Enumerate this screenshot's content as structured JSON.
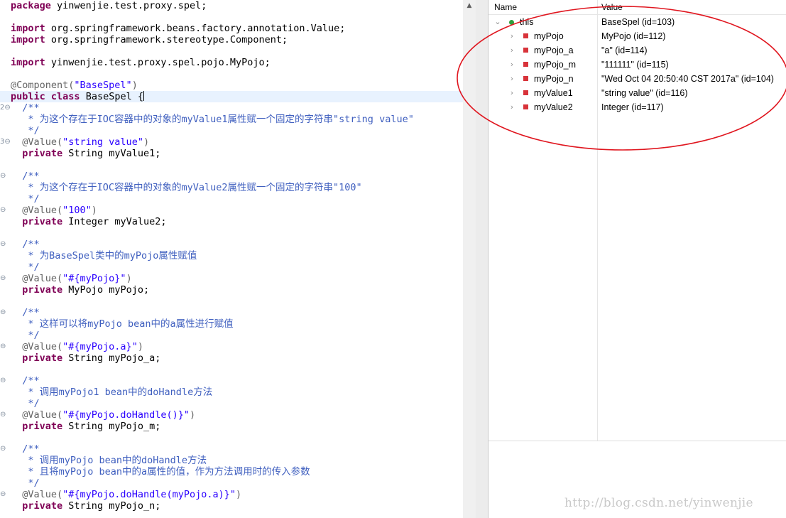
{
  "editor": {
    "lines": [
      {
        "gutter": "",
        "segments": [
          {
            "t": "package",
            "c": "kw"
          },
          {
            "t": " yinwenjie.test.proxy.spel;",
            "c": ""
          }
        ]
      },
      {
        "gutter": "",
        "segments": []
      },
      {
        "gutter": "",
        "segments": [
          {
            "t": "import",
            "c": "kw"
          },
          {
            "t": " org.springframework.beans.factory.annotation.Value;",
            "c": ""
          }
        ]
      },
      {
        "gutter": "",
        "segments": [
          {
            "t": "import",
            "c": "kw"
          },
          {
            "t": " org.springframework.stereotype.Component;",
            "c": ""
          }
        ]
      },
      {
        "gutter": "",
        "segments": []
      },
      {
        "gutter": "",
        "segments": [
          {
            "t": "import",
            "c": "kw"
          },
          {
            "t": " yinwenjie.test.proxy.spel.pojo.MyPojo;",
            "c": ""
          }
        ]
      },
      {
        "gutter": "",
        "segments": []
      },
      {
        "gutter": "",
        "segments": [
          {
            "t": "@Component(",
            "c": "ann"
          },
          {
            "t": "\"BaseSpel\"",
            "c": "str"
          },
          {
            "t": ")",
            "c": "ann"
          }
        ]
      },
      {
        "gutter": "",
        "current": true,
        "segments": [
          {
            "t": "public",
            "c": "kw"
          },
          {
            "t": " ",
            "c": ""
          },
          {
            "t": "class",
            "c": "kw"
          },
          {
            "t": " BaseSpel {",
            "c": ""
          }
        ]
      },
      {
        "gutter": "2⊖",
        "segments": [
          {
            "t": "  /**",
            "c": "doc"
          }
        ]
      },
      {
        "gutter": "",
        "segments": [
          {
            "t": "   * 为这个存在于IOC容器中的对象的myValue1属性赋一个固定的字符串\"string value\"",
            "c": "doc"
          }
        ]
      },
      {
        "gutter": "",
        "segments": [
          {
            "t": "   */",
            "c": "doc"
          }
        ]
      },
      {
        "gutter": "3⊖",
        "segments": [
          {
            "t": "  @Value(",
            "c": "ann"
          },
          {
            "t": "\"string value\"",
            "c": "str"
          },
          {
            "t": ")",
            "c": "ann"
          }
        ]
      },
      {
        "gutter": "",
        "segments": [
          {
            "t": "  ",
            "c": ""
          },
          {
            "t": "private",
            "c": "kw"
          },
          {
            "t": " String myValue1;",
            "c": ""
          }
        ]
      },
      {
        "gutter": "",
        "segments": []
      },
      {
        "gutter": "⊖",
        "segments": [
          {
            "t": "  /**",
            "c": "doc"
          }
        ]
      },
      {
        "gutter": "",
        "segments": [
          {
            "t": "   * 为这个存在于IOC容器中的对象的myValue2属性赋一个固定的字符串\"100\"",
            "c": "doc"
          }
        ]
      },
      {
        "gutter": "",
        "segments": [
          {
            "t": "   */",
            "c": "doc"
          }
        ]
      },
      {
        "gutter": "⊖",
        "segments": [
          {
            "t": "  @Value(",
            "c": "ann"
          },
          {
            "t": "\"100\"",
            "c": "str"
          },
          {
            "t": ")",
            "c": "ann"
          }
        ]
      },
      {
        "gutter": "",
        "segments": [
          {
            "t": "  ",
            "c": ""
          },
          {
            "t": "private",
            "c": "kw"
          },
          {
            "t": " Integer myValue2;",
            "c": ""
          }
        ]
      },
      {
        "gutter": "",
        "segments": []
      },
      {
        "gutter": "⊖",
        "segments": [
          {
            "t": "  /**",
            "c": "doc"
          }
        ]
      },
      {
        "gutter": "",
        "segments": [
          {
            "t": "   * 为BaseSpel类中的myPojo属性赋值",
            "c": "doc"
          }
        ]
      },
      {
        "gutter": "",
        "segments": [
          {
            "t": "   */",
            "c": "doc"
          }
        ]
      },
      {
        "gutter": "⊖",
        "segments": [
          {
            "t": "  @Value(",
            "c": "ann"
          },
          {
            "t": "\"#{myPojo}\"",
            "c": "str"
          },
          {
            "t": ")",
            "c": "ann"
          }
        ]
      },
      {
        "gutter": "",
        "segments": [
          {
            "t": "  ",
            "c": ""
          },
          {
            "t": "private",
            "c": "kw"
          },
          {
            "t": " MyPojo myPojo;",
            "c": ""
          }
        ]
      },
      {
        "gutter": "",
        "segments": []
      },
      {
        "gutter": "⊖",
        "segments": [
          {
            "t": "  /**",
            "c": "doc"
          }
        ]
      },
      {
        "gutter": "",
        "segments": [
          {
            "t": "   * 这样可以将myPojo bean中的a属性进行赋值",
            "c": "doc"
          }
        ]
      },
      {
        "gutter": "",
        "segments": [
          {
            "t": "   */",
            "c": "doc"
          }
        ]
      },
      {
        "gutter": "⊖",
        "segments": [
          {
            "t": "  @Value(",
            "c": "ann"
          },
          {
            "t": "\"#{myPojo.a}\"",
            "c": "str"
          },
          {
            "t": ")",
            "c": "ann"
          }
        ]
      },
      {
        "gutter": "",
        "segments": [
          {
            "t": "  ",
            "c": ""
          },
          {
            "t": "private",
            "c": "kw"
          },
          {
            "t": " String myPojo_a;",
            "c": ""
          }
        ]
      },
      {
        "gutter": "",
        "segments": []
      },
      {
        "gutter": "⊖",
        "segments": [
          {
            "t": "  /**",
            "c": "doc"
          }
        ]
      },
      {
        "gutter": "",
        "segments": [
          {
            "t": "   * 调用myPojo1 bean中的doHandle方法",
            "c": "doc"
          }
        ]
      },
      {
        "gutter": "",
        "segments": [
          {
            "t": "   */",
            "c": "doc"
          }
        ]
      },
      {
        "gutter": "⊖",
        "segments": [
          {
            "t": "  @Value(",
            "c": "ann"
          },
          {
            "t": "\"#{myPojo.doHandle()}\"",
            "c": "str"
          },
          {
            "t": ")",
            "c": "ann"
          }
        ]
      },
      {
        "gutter": "",
        "segments": [
          {
            "t": "  ",
            "c": ""
          },
          {
            "t": "private",
            "c": "kw"
          },
          {
            "t": " String myPojo_m;",
            "c": ""
          }
        ]
      },
      {
        "gutter": "",
        "segments": []
      },
      {
        "gutter": "⊖",
        "segments": [
          {
            "t": "  /**",
            "c": "doc"
          }
        ]
      },
      {
        "gutter": "",
        "segments": [
          {
            "t": "   * 调用myPojo bean中的doHandle方法",
            "c": "doc"
          }
        ]
      },
      {
        "gutter": "",
        "segments": [
          {
            "t": "   * 且将myPojo bean中的a属性的值，作为方法调用时的传入参数",
            "c": "doc"
          }
        ]
      },
      {
        "gutter": "",
        "segments": [
          {
            "t": "   */",
            "c": "doc"
          }
        ]
      },
      {
        "gutter": "⊖",
        "segments": [
          {
            "t": "  @Value(",
            "c": "ann"
          },
          {
            "t": "\"#{myPojo.doHandle(myPojo.a)}\"",
            "c": "str"
          },
          {
            "t": ")",
            "c": "ann"
          }
        ]
      },
      {
        "gutter": "",
        "segments": [
          {
            "t": "  ",
            "c": ""
          },
          {
            "t": "private",
            "c": "kw"
          },
          {
            "t": " String myPojo_n;",
            "c": ""
          }
        ]
      }
    ]
  },
  "variables": {
    "col_name": "Name",
    "col_value": "Value",
    "rows": [
      {
        "name": "this",
        "value": "BaseSpel  (id=103)",
        "expanded": true,
        "level": 0,
        "icon": "green-dot-icon"
      },
      {
        "name": "myPojo",
        "value": "MyPojo  (id=112)",
        "level": 1,
        "icon": "red-square-icon"
      },
      {
        "name": "myPojo_a",
        "value": "\"a\" (id=114)",
        "level": 1,
        "icon": "red-square-icon"
      },
      {
        "name": "myPojo_m",
        "value": "\"111111\" (id=115)",
        "level": 1,
        "icon": "red-square-icon"
      },
      {
        "name": "myPojo_n",
        "value": "\"Wed Oct 04 20:50:40 CST 2017a\" (id=104)",
        "level": 1,
        "icon": "red-square-icon"
      },
      {
        "name": "myValue1",
        "value": "\"string value\" (id=116)",
        "level": 1,
        "icon": "red-square-icon"
      },
      {
        "name": "myValue2",
        "value": "Integer  (id=117)",
        "level": 1,
        "icon": "red-square-icon"
      }
    ]
  },
  "watermark": "http://blog.csdn.net/yinwenjie",
  "colors": {
    "keyword": "#7f0055",
    "annotation": "#646464",
    "string": "#2a00ff",
    "javadoc": "#3f5fbf",
    "highlight_ellipse": "#e0161f"
  }
}
